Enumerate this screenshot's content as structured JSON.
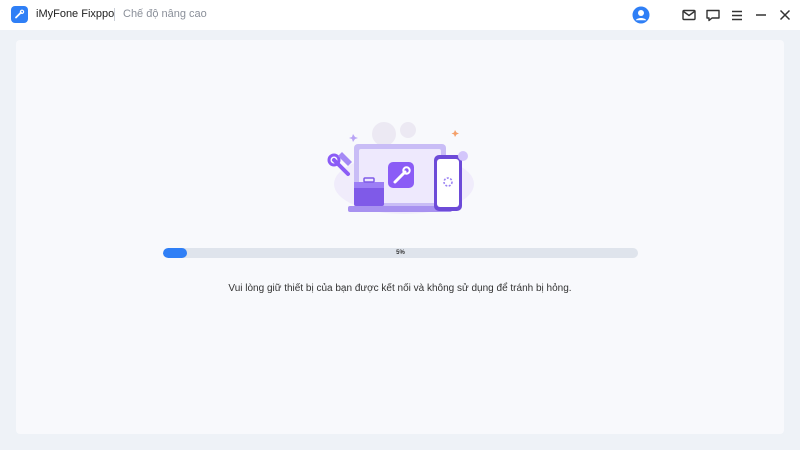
{
  "titlebar": {
    "app_name": "iMyFone Fixppo",
    "mode": "Chế độ nâng cao",
    "icons": [
      "user-icon",
      "mail-icon",
      "feedback-icon",
      "menu-icon",
      "minimize-icon",
      "close-icon"
    ]
  },
  "progress": {
    "value": 5,
    "label": "5%"
  },
  "message": "Vui lòng giữ thiết bị của bạn được kết nối và không sử dụng để tránh bị hỏng.",
  "colors": {
    "accent": "#2f7ff6",
    "illustration_purple": "#8b5cf6"
  }
}
